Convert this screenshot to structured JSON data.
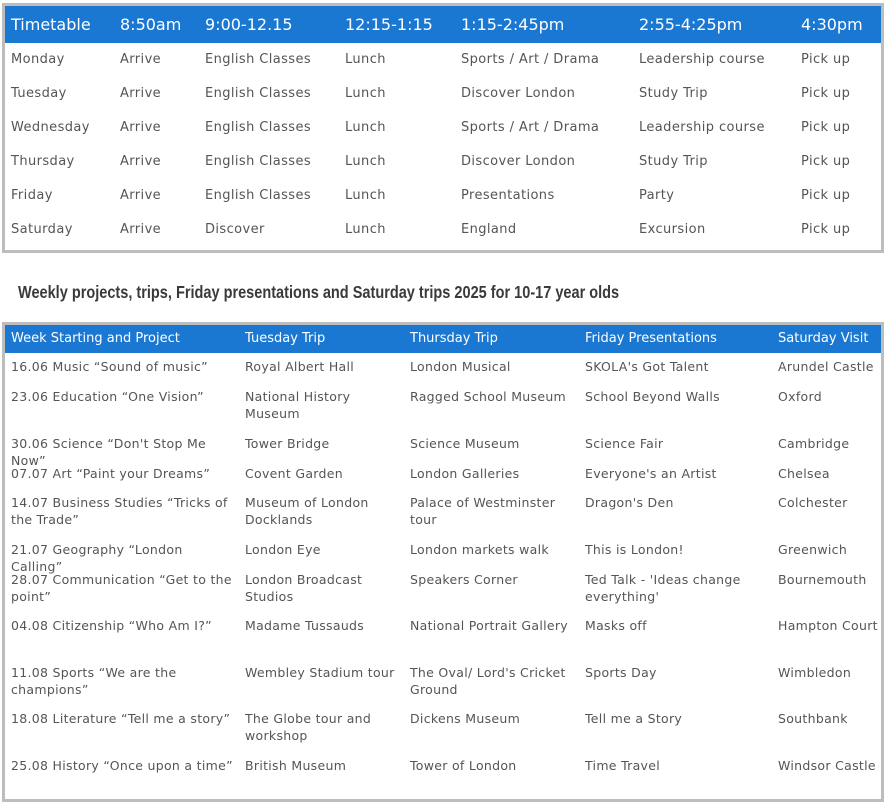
{
  "timetable": {
    "headers": [
      "Timetable",
      "8:50am",
      "9:00-12.15",
      "12:15-1:15",
      "1:15-2:45pm",
      "2:55-4:25pm",
      "4:30pm"
    ],
    "rows": [
      [
        "Monday",
        "Arrive",
        "English Classes",
        "Lunch",
        "Sports / Art / Drama",
        "Leadership course",
        "Pick up"
      ],
      [
        "Tuesday",
        "Arrive",
        "English Classes",
        "Lunch",
        "Discover London",
        "Study Trip",
        "Pick up"
      ],
      [
        "Wednesday",
        "Arrive",
        "English Classes",
        "Lunch",
        "Sports / Art / Drama",
        "Leadership course",
        "Pick up"
      ],
      [
        "Thursday",
        "Arrive",
        "English Classes",
        "Lunch",
        "Discover London",
        "Study Trip",
        "Pick up"
      ],
      [
        "Friday",
        "Arrive",
        "English Classes",
        "Lunch",
        "Presentations",
        "Party",
        "Pick up"
      ],
      [
        "Saturday",
        "Arrive",
        "Discover",
        "Lunch",
        "England",
        "Excursion",
        "Pick up"
      ]
    ]
  },
  "weekly": {
    "title": "Weekly projects, trips, Friday presentations and Saturday trips 2025 for 10-17 year olds",
    "headers": [
      "Week Starting and Project",
      "Tuesday Trip",
      "Thursday Trip",
      "Friday Presentations",
      "Saturday Visit"
    ],
    "rows": [
      [
        "16.06 Music “Sound of music”",
        "Royal Albert Hall",
        "London Musical",
        "SKOLA's Got Talent",
        "Arundel Castle"
      ],
      [
        "23.06 Education “One Vision”",
        "National History Museum",
        "Ragged School Museum",
        "School Beyond Walls",
        "Oxford"
      ],
      [
        "30.06 Science “Don't Stop Me Now”",
        "Tower Bridge",
        "Science Museum",
        "Science Fair",
        "Cambridge"
      ],
      [
        "07.07 Art “Paint your Dreams”",
        "Covent Garden",
        "London Galleries",
        "Everyone's an Artist",
        "Chelsea"
      ],
      [
        "14.07 Business Studies “Tricks of the Trade”",
        "Museum of London Docklands",
        "Palace of Westminster tour",
        "Dragon's Den",
        "Colchester"
      ],
      [
        "21.07 Geography “London Calling”",
        "London Eye",
        "London markets walk",
        "This is London!",
        "Greenwich"
      ],
      [
        "28.07 Communication “Get to the point”",
        "London Broadcast Studios",
        "Speakers Corner",
        "Ted Talk - 'Ideas change everything'",
        "Bournemouth"
      ],
      [
        "04.08 Citizenship “Who Am I?”",
        "Madame Tussauds",
        "National Portrait Gallery",
        "Masks off",
        "Hampton Court"
      ],
      [
        "11.08 Sports “We are the champions”",
        "Wembley Stadium tour",
        "The Oval/ Lord's Cricket Ground",
        "Sports Day",
        "Wimbledon"
      ],
      [
        "18.08 Literature “Tell me a story”",
        "The Globe tour and workshop",
        "Dickens Museum",
        "Tell me a Story",
        "Southbank"
      ],
      [
        "25.08 History “Once upon a time”",
        "British Museum",
        "Tower of London",
        "Time Travel",
        "Windsor Castle"
      ]
    ]
  }
}
